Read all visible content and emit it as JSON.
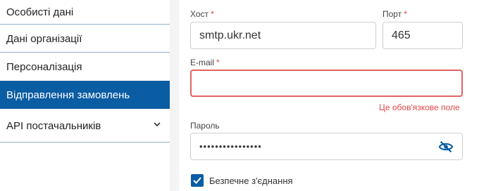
{
  "sidebar": {
    "items": [
      {
        "label": "Особисті дані"
      },
      {
        "label": "Дані організації"
      },
      {
        "label": "Персоналізація"
      },
      {
        "label": "Відправлення замовлень"
      },
      {
        "label": "API постачальників"
      }
    ]
  },
  "form": {
    "host": {
      "label": "Хост",
      "required_mark": "*",
      "value": "smtp.ukr.net"
    },
    "port": {
      "label": "Порт",
      "required_mark": "*",
      "value": "465"
    },
    "email": {
      "label": "E-mail",
      "required_mark": "*",
      "value": "",
      "error": "Це обов'язкове поле"
    },
    "password": {
      "label": "Пароль",
      "value": "••••••••••••••••"
    },
    "secure": {
      "label": "Безпечне з'єднання",
      "checked": true
    }
  },
  "colors": {
    "accent": "#0a5ca3",
    "error": "#e04646"
  }
}
